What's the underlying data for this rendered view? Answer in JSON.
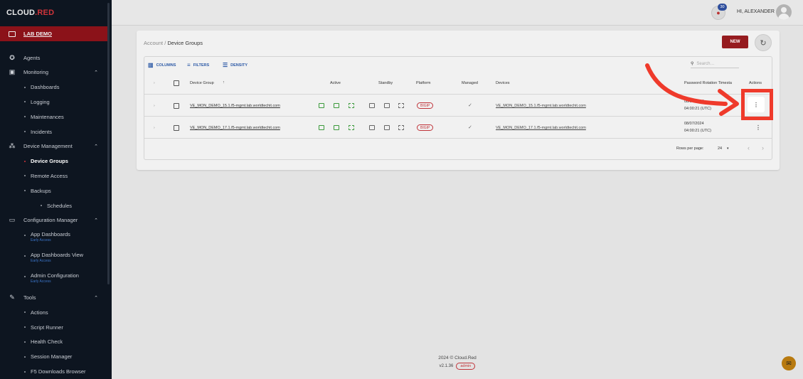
{
  "brand": {
    "cloud": "CL",
    "o": "O",
    "ud": "UD",
    "dot": ".",
    "red": "RED"
  },
  "sidebar": {
    "lab": "LAB DEMO",
    "items": [
      {
        "type": "top",
        "label": "Agents",
        "icon": "agents-icon",
        "glyph": "✪"
      },
      {
        "type": "top",
        "label": "Monitoring",
        "icon": "monitoring-icon",
        "glyph": "▣",
        "chevron": "⌃"
      },
      {
        "type": "sub",
        "label": "Dashboards"
      },
      {
        "type": "sub",
        "label": "Logging"
      },
      {
        "type": "sub",
        "label": "Maintenances"
      },
      {
        "type": "sub",
        "label": "Incidents"
      },
      {
        "type": "top",
        "label": "Device Management",
        "icon": "device-management-icon",
        "glyph": "⁂",
        "chevron": "⌃"
      },
      {
        "type": "sub",
        "label": "Device Groups",
        "active": true
      },
      {
        "type": "sub",
        "label": "Remote Access"
      },
      {
        "type": "sub",
        "label": "Backups"
      },
      {
        "type": "sub2",
        "label": "Schedules"
      },
      {
        "type": "top",
        "label": "Configuration Manager",
        "icon": "configuration-manager-icon",
        "glyph": "▭",
        "chevron": "⌃"
      },
      {
        "type": "sub",
        "label": "App Dashboards",
        "early": "Early Access"
      },
      {
        "type": "sub",
        "label": "App Dashboards View",
        "early": "Early Access"
      },
      {
        "type": "sub",
        "label": "Admin Configuration",
        "early": "Early Access"
      },
      {
        "type": "top",
        "label": "Tools",
        "icon": "tools-icon",
        "glyph": "✎",
        "chevron": "⌃"
      },
      {
        "type": "sub",
        "label": "Actions"
      },
      {
        "type": "sub",
        "label": "Script Runner"
      },
      {
        "type": "sub",
        "label": "Health Check"
      },
      {
        "type": "sub",
        "label": "Session Manager"
      },
      {
        "type": "sub",
        "label": "F5 Downloads Browser"
      }
    ]
  },
  "topbar": {
    "notification_count": "30",
    "greeting": "HI, ALEXANDER"
  },
  "page": {
    "breadcrumb_root": "Account",
    "breadcrumb_sep": "/",
    "breadcrumb_current": "Device Groups",
    "new_label": "NEW"
  },
  "toolbar": {
    "columns": "COLUMNS",
    "filters": "FILTERS",
    "density": "DENSITY",
    "search_placeholder": "Search…"
  },
  "table": {
    "headers": {
      "device_group": "Device Group",
      "sort": "↑",
      "active": "Active",
      "standby": "Standby",
      "platform": "Platform",
      "managed": "Managed",
      "devices": "Devices",
      "password_rotation": "Password Rotation Timesta",
      "actions": "Actions"
    },
    "rows": [
      {
        "group": "VE_MON_DEMO_15.1.f5-mgmt.lab.worldtechit.com",
        "platform": "BIGIP",
        "managed": "✓",
        "devices": "VE_MON_DEMO_15.1.f5-mgmt.lab.worldtechit.com",
        "rotation_date": "08/07/2024",
        "rotation_time": "04:00:21 (UTC)",
        "actions": "⋮"
      },
      {
        "group": "VE_MON_DEMO_17.1.f5-mgmt.lab.worldtechit.com",
        "platform": "BIGIP",
        "managed": "✓",
        "devices": "VE_MON_DEMO_17.1.f5-mgmt.lab.worldtechit.com",
        "rotation_date": "08/07/2024",
        "rotation_time": "04:00:21 (UTC)",
        "actions": "⋮"
      }
    ],
    "pager": {
      "label": "Rows per page:",
      "value": "24",
      "prev": "‹",
      "next": "›"
    }
  },
  "footer": {
    "copyright": "2024 © Cloud.Red",
    "version": "v2.1.36",
    "role": "admin"
  },
  "colors": {
    "accent_red": "#961c20",
    "highlight": "#ef3a2b",
    "sidebar_bg": "#0d1520",
    "link_blue": "#2d5aa6"
  }
}
